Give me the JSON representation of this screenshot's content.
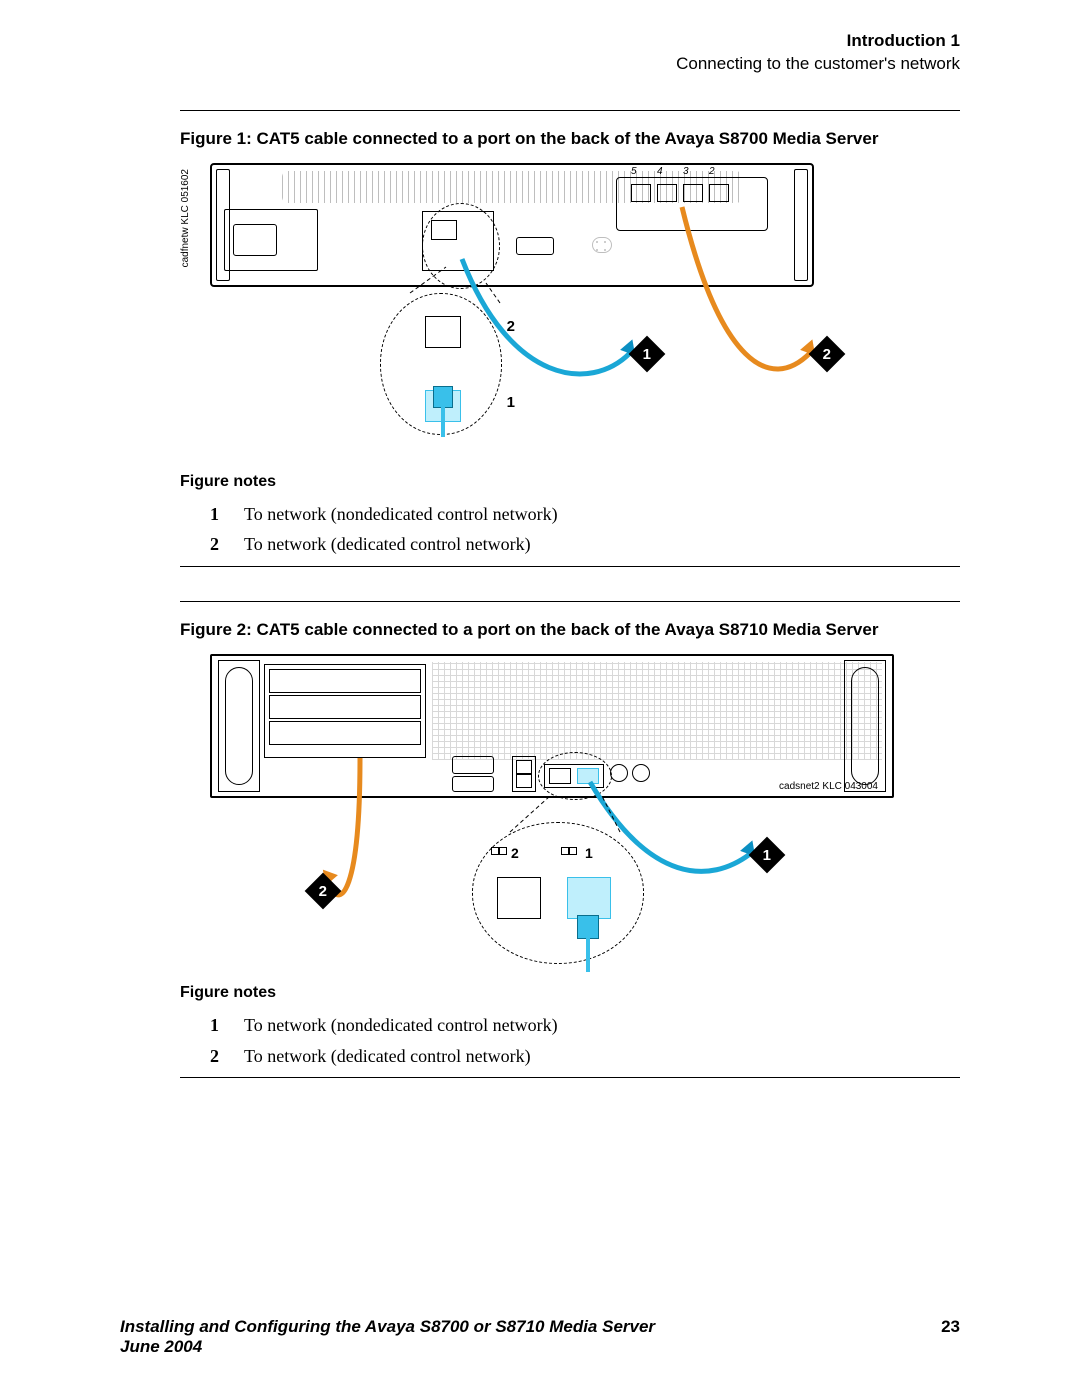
{
  "header": {
    "chapter": "Introduction 1",
    "section": "Connecting to the customer's network"
  },
  "figure1": {
    "caption": "Figure 1: CAT5 cable connected to a port on the back of the Avaya S8700 Media Server",
    "side_label": "cadfnetw KLC 051602",
    "port_labels": {
      "p5": "5",
      "p4": "4",
      "p3": "3",
      "p2": "2"
    },
    "zoom": {
      "label1": "1",
      "label2": "2"
    },
    "markers": {
      "m1": "1",
      "m2": "2"
    },
    "notes_heading": "Figure notes",
    "notes": [
      {
        "num": "1",
        "text": "To network (nondedicated control network)"
      },
      {
        "num": "2",
        "text": "To network (dedicated control network)"
      }
    ]
  },
  "figure2": {
    "caption": "Figure 2: CAT5 cable connected to a port on the back of the Avaya S8710 Media Server",
    "credit": "cadsnet2 KLC 043004",
    "zoom": {
      "left_icon_label": "2",
      "right_icon_label": "1"
    },
    "markers": {
      "m1": "1",
      "m2": "2"
    },
    "notes_heading": "Figure notes",
    "notes": [
      {
        "num": "1",
        "text": "To network (nondedicated control network)"
      },
      {
        "num": "2",
        "text": "To network (dedicated control network)"
      }
    ]
  },
  "footer": {
    "title": "Installing and Configuring the Avaya S8700 or S8710 Media Server",
    "date": "June 2004",
    "page": "23"
  }
}
